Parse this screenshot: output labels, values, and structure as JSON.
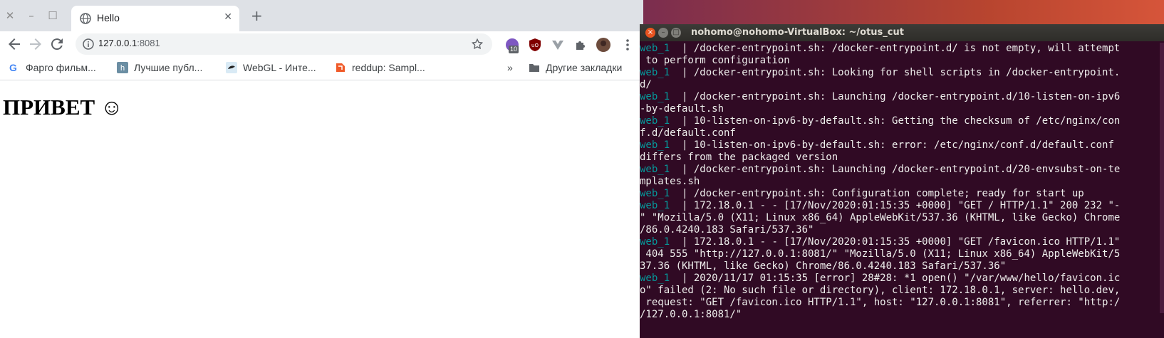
{
  "browser": {
    "tab_title": "Hello",
    "tab_close": "✕",
    "new_tab": "+",
    "url_host": "127.0.0.1",
    "url_port": ":8081",
    "extension_badge": "10",
    "bookmarks": [
      {
        "label": "Фарго фильм...",
        "icon": "google-icon"
      },
      {
        "label": "Лучшие публ...",
        "icon": "habr-icon"
      },
      {
        "label": "WebGL - Инте...",
        "icon": "webgl-icon"
      },
      {
        "label": "reddup: Sampl...",
        "icon": "reddup-icon"
      }
    ],
    "bookmarks_overflow": "»",
    "other_bookmarks": "Другие закладки",
    "page_heading": "ПРИВЕТ ☺"
  },
  "terminal": {
    "title": "nohomo@nohomo-VirtualBox: ~/otus_cut",
    "lines": [
      {
        "tag": "web_1  ",
        "text": "| /docker-entrypoint.sh: /docker-entrypoint.d/ is not empty, will attempt"
      },
      {
        "tag": "",
        "text": " to perform configuration"
      },
      {
        "tag": "web_1  ",
        "text": "| /docker-entrypoint.sh: Looking for shell scripts in /docker-entrypoint."
      },
      {
        "tag": "",
        "text": "d/"
      },
      {
        "tag": "web_1  ",
        "text": "| /docker-entrypoint.sh: Launching /docker-entrypoint.d/10-listen-on-ipv6"
      },
      {
        "tag": "",
        "text": "-by-default.sh"
      },
      {
        "tag": "web_1  ",
        "text": "| 10-listen-on-ipv6-by-default.sh: Getting the checksum of /etc/nginx/con"
      },
      {
        "tag": "",
        "text": "f.d/default.conf"
      },
      {
        "tag": "web_1  ",
        "text": "| 10-listen-on-ipv6-by-default.sh: error: /etc/nginx/conf.d/default.conf"
      },
      {
        "tag": "",
        "text": "differs from the packaged version"
      },
      {
        "tag": "web_1  ",
        "text": "| /docker-entrypoint.sh: Launching /docker-entrypoint.d/20-envsubst-on-te"
      },
      {
        "tag": "",
        "text": "mplates.sh"
      },
      {
        "tag": "web_1  ",
        "text": "| /docker-entrypoint.sh: Configuration complete; ready for start up"
      },
      {
        "tag": "web_1  ",
        "text": "| 172.18.0.1 - - [17/Nov/2020:01:15:35 +0000] \"GET / HTTP/1.1\" 200 232 \"-"
      },
      {
        "tag": "",
        "text": "\" \"Mozilla/5.0 (X11; Linux x86_64) AppleWebKit/537.36 (KHTML, like Gecko) Chrome"
      },
      {
        "tag": "",
        "text": "/86.0.4240.183 Safari/537.36\""
      },
      {
        "tag": "web_1  ",
        "text": "| 172.18.0.1 - - [17/Nov/2020:01:15:35 +0000] \"GET /favicon.ico HTTP/1.1\""
      },
      {
        "tag": "",
        "text": " 404 555 \"http://127.0.0.1:8081/\" \"Mozilla/5.0 (X11; Linux x86_64) AppleWebKit/5"
      },
      {
        "tag": "",
        "text": "37.36 (KHTML, like Gecko) Chrome/86.0.4240.183 Safari/537.36\""
      },
      {
        "tag": "web_1  ",
        "text": "| 2020/11/17 01:15:35 [error] 28#28: *1 open() \"/var/www/hello/favicon.ic"
      },
      {
        "tag": "",
        "text": "o\" failed (2: No such file or directory), client: 172.18.0.1, server: hello.dev,"
      },
      {
        "tag": "",
        "text": " request: \"GET /favicon.ico HTTP/1.1\", host: \"127.0.0.1:8081\", referrer: \"http:/"
      },
      {
        "tag": "",
        "text": "/127.0.0.1:8081/\""
      }
    ]
  },
  "colors": {
    "terminal_bg": "#300a24",
    "terminal_tag": "#06989a",
    "ubuntu_orange": "#e95420"
  }
}
